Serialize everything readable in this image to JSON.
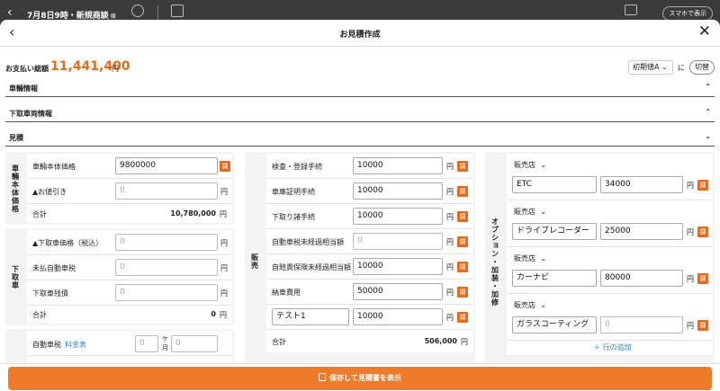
{
  "app": {
    "back_glyph": "‹",
    "title": "7月8日9時・新規商談",
    "title_suffix": "様",
    "smartphone_button": "スマホで表示"
  },
  "modal": {
    "title": "お見積作成",
    "back_glyph": "‹",
    "close_glyph": "✕"
  },
  "summary": {
    "label": "お支払い総額",
    "amount": "11,441,400",
    "unit": "円",
    "preset_value": "初期値A",
    "preset_chevron": "⌄",
    "ni": "に",
    "switch_button": "切替"
  },
  "sections": [
    {
      "label": "車輛情報",
      "chevron": "⌃"
    },
    {
      "label": "下取車両情報",
      "chevron": "⌃"
    },
    {
      "label": "見積",
      "chevron": "⌄"
    }
  ],
  "vehicle_price": {
    "label": "車輛本体価格",
    "rows": [
      {
        "label": "車輛本体価格",
        "value": "9800000",
        "unit": "円",
        "tax": "課"
      },
      {
        "label": "▲お値引き",
        "placeholder": "0",
        "unit": "円"
      }
    ],
    "total_label": "合計",
    "total_value": "10,780,000",
    "total_unit": "円"
  },
  "trade_in": {
    "label": "下取車",
    "rows": [
      {
        "label": "▲下取車価格（税込）",
        "placeholder": "0",
        "unit": "円"
      },
      {
        "label": "未払自動車税",
        "placeholder": "0",
        "unit": "円"
      },
      {
        "label": "下取車残債",
        "placeholder": "0",
        "unit": "円"
      }
    ],
    "total_label": "合計",
    "total_value": "0",
    "total_unit": "円"
  },
  "auto_tax": {
    "label": "自動車税",
    "link": "料金表",
    "months_placeholder": "0",
    "months_unit_1": "ケ",
    "months_unit_2": "月",
    "amount_placeholder": "0"
  },
  "sales": {
    "label": "販売",
    "rows": [
      {
        "label": "検査・登録手続",
        "value": "10000",
        "unit": "円",
        "tax": "課"
      },
      {
        "label": "車庫証明手続",
        "value": "10000",
        "unit": "円",
        "tax": "課"
      },
      {
        "label": "下取り諸手続",
        "value": "10000",
        "unit": "円",
        "tax": "課"
      },
      {
        "label": "自動車税未経過相当額",
        "placeholder": "0",
        "unit": "円",
        "tax": "課"
      },
      {
        "label": "自賠責保険未経過相当額",
        "value": "10000",
        "unit": "円",
        "tax": "課"
      },
      {
        "label": "納車費用",
        "value": "50000",
        "unit": "円",
        "tax": "課"
      },
      {
        "custom_label": "テスト1",
        "value": "10000",
        "unit": "円",
        "tax": "課"
      }
    ],
    "total_label": "合計",
    "total_value": "506,000",
    "total_unit": "円"
  },
  "options": {
    "label": "オプション・加装・加修",
    "items": [
      {
        "store": "販売店",
        "name": "ETC",
        "value": "34000",
        "unit": "円",
        "tax": "課"
      },
      {
        "store": "販売店",
        "name": "ドライブレコーダー",
        "value": "25000",
        "unit": "円",
        "tax": "課"
      },
      {
        "store": "販売店",
        "name": "カーナビ",
        "value": "80000",
        "unit": "円",
        "tax": "課"
      },
      {
        "store": "販売店",
        "name": "ガラスコーティング",
        "placeholder": "0",
        "unit": "円",
        "tax": "課"
      }
    ],
    "select_chevron": "⌄",
    "add_row": "＋ 行の追加"
  },
  "footer": {
    "save_button": "保存して見積書を表示"
  },
  "colors": {
    "accent": "#ef7a2a",
    "amount": "#e56a1c",
    "link": "#2f86c8",
    "topbar": "#3b3b3b"
  }
}
